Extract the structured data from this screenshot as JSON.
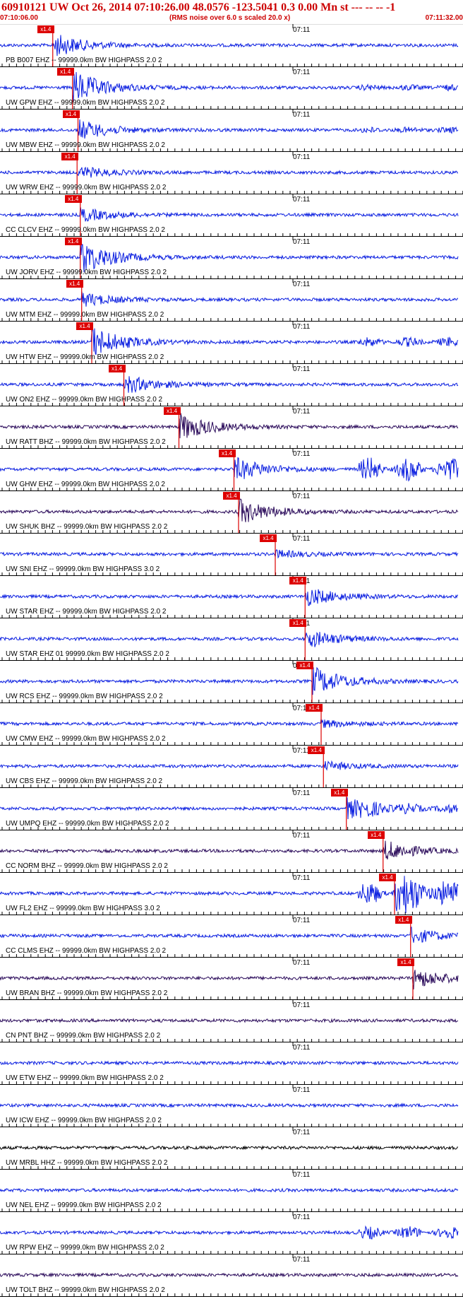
{
  "header": {
    "title": "60910121 UW Oct 26, 2014 07:10:26.00   48.0576 -123.5041  0.3 0.00 Mn st --- -- --  -1",
    "start_time": "07:10:06.00",
    "end_time": "07:11:32.00",
    "rms_note": "(RMS noise over 6.0 s scaled 20.0 x)"
  },
  "colors": {
    "trace_blue": "#0a1ee0",
    "trace_purple": "#2a0a5a",
    "trace_black": "#000000",
    "pick_red": "#dd0000",
    "header_red": "#cc0000"
  },
  "traces": [
    {
      "label": "PB B007 EHZ -- 99999.0km BW  HIGHPASS  2.0  2",
      "tick_label": "07:11",
      "pick_label": "x1.4",
      "color": "#0a1ee0",
      "pick_frac": 0.115,
      "event": 0.7,
      "later": 0.0
    },
    {
      "label": "UW GPW EHZ -- 99999.0km BW  HIGHPASS  2.0  2",
      "tick_label": "07:11",
      "pick_label": "x1.4",
      "color": "#0a1ee0",
      "pick_frac": 0.158,
      "event": 1.0,
      "later": 0.15
    },
    {
      "label": "UW MBW EHZ -- 99999.0km BW  HIGHPASS  2.0  2",
      "tick_label": "07:11",
      "pick_label": "x1.4",
      "color": "#0a1ee0",
      "pick_frac": 0.17,
      "event": 0.6,
      "later": 0.15
    },
    {
      "label": "UW WRW EHZ -- 99999.0km BW  HIGHPASS  2.0  2",
      "tick_label": "07:11",
      "pick_label": "x1.4",
      "color": "#0a1ee0",
      "pick_frac": 0.168,
      "event": 0.35,
      "later": 0.0
    },
    {
      "label": "CC CLCV EHZ -- 99999.0km BW  HIGHPASS  2.0  2",
      "tick_label": "07:11",
      "pick_label": "x1.4",
      "color": "#0a1ee0",
      "pick_frac": 0.175,
      "event": 0.4,
      "later": 0.0
    },
    {
      "label": "UW JORV EHZ -- 99999.0km BW  HIGHPASS  2.0  2",
      "tick_label": "07:11",
      "pick_label": "x1.4",
      "color": "#0a1ee0",
      "pick_frac": 0.175,
      "event": 1.0,
      "later": 0.0
    },
    {
      "label": "UW MTM EHZ -- 99999.0km BW  HIGHPASS  2.0  2",
      "tick_label": "07:11",
      "pick_label": "x1.4",
      "color": "#0a1ee0",
      "pick_frac": 0.178,
      "event": 0.4,
      "later": 0.0
    },
    {
      "label": "UW HTW EHZ -- 99999.0km BW  HIGHPASS  2.0  2",
      "tick_label": "07:11",
      "pick_label": "x1.4",
      "color": "#0a1ee0",
      "pick_frac": 0.2,
      "event": 0.9,
      "later": 0.3
    },
    {
      "label": "UW ON2 EHZ -- 99999.0km BW  HIGHPASS  2.0  2",
      "tick_label": "07:11",
      "pick_label": "x1.4",
      "color": "#0a1ee0",
      "pick_frac": 0.27,
      "event": 0.55,
      "later": 0.0
    },
    {
      "label": "UW RATT BHZ -- 99999.0km BW  HIGHPASS  2.0  2",
      "tick_label": "07:11",
      "pick_label": "x1.4",
      "color": "#2a0a5a",
      "pick_frac": 0.39,
      "event": 0.8,
      "later": 0.0
    },
    {
      "label": "UW GHW EHZ -- 99999.0km BW  HIGHPASS  2.0  2",
      "tick_label": "07:11",
      "pick_label": "x1.4",
      "color": "#0a1ee0",
      "pick_frac": 0.51,
      "event": 0.7,
      "later": 0.95
    },
    {
      "label": "UW SHUK BHZ -- 99999.0km BW  HIGHPASS  2.0  2",
      "tick_label": "07:11",
      "pick_label": "x1.4",
      "color": "#2a0a5a",
      "pick_frac": 0.52,
      "event": 0.75,
      "later": 0.0
    },
    {
      "label": "UW SNI EHZ -- 99999.0km BW  HIGHPASS  3.0  2",
      "tick_label": "07:11",
      "pick_label": "x1.4",
      "color": "#0a1ee0",
      "pick_frac": 0.6,
      "event": 0.2,
      "later": 0.0
    },
    {
      "label": "UW STAR EHZ -- 99999.0km BW  HIGHPASS  2.0  2",
      "tick_label": "07:11",
      "pick_label": "x1.4",
      "color": "#0a1ee0",
      "pick_frac": 0.665,
      "event": 0.55,
      "later": 0.0
    },
    {
      "label": "UW STAR EHZ 01 99999.0km BW  HIGHPASS  2.0  2",
      "tick_label": "07:11",
      "pick_label": "x1.4",
      "color": "#0a1ee0",
      "pick_frac": 0.665,
      "event": 0.55,
      "later": 0.0
    },
    {
      "label": "UW RCS EHZ -- 99999.0km BW  HIGHPASS  2.0  2",
      "tick_label": "07:11",
      "pick_label": "x1.4",
      "color": "#0a1ee0",
      "pick_frac": 0.68,
      "event": 0.85,
      "later": 0.0
    },
    {
      "label": "UW CMW EHZ -- 99999.0km BW  HIGHPASS  2.0  2",
      "tick_label": "07:11",
      "pick_label": "x1.4",
      "color": "#0a1ee0",
      "pick_frac": 0.7,
      "event": 0.2,
      "later": 0.0
    },
    {
      "label": "UW CBS EHZ -- 99999.0km BW  HIGHPASS  2.0  2",
      "tick_label": "07:11",
      "pick_label": "x1.4",
      "color": "#0a1ee0",
      "pick_frac": 0.705,
      "event": 0.25,
      "later": 0.0
    },
    {
      "label": "UW UMPQ EHZ -- 99999.0km BW  HIGHPASS  2.0  2",
      "tick_label": "07:11",
      "pick_label": "x1.4",
      "color": "#0a1ee0",
      "pick_frac": 0.755,
      "event": 0.6,
      "later": 0.25
    },
    {
      "label": "CC NORM BHZ -- 99999.0km BW  HIGHPASS  2.0  2",
      "tick_label": "07:11",
      "pick_label": "x1.4",
      "color": "#2a0a5a",
      "pick_frac": 0.835,
      "event": 0.6,
      "later": 0.0
    },
    {
      "label": "UW FL2 EHZ -- 99999.0km BW  HIGHPASS  3.0  2",
      "tick_label": "07:11",
      "pick_label": "x1.4",
      "color": "#0a1ee0",
      "pick_frac": 0.86,
      "event": 0.9,
      "later": 0.9
    },
    {
      "label": "CC CLMS EHZ -- 99999.0km BW  HIGHPASS  2.0  2",
      "tick_label": "07:11",
      "pick_label": "x1.4",
      "color": "#0a1ee0",
      "pick_frac": 0.895,
      "event": 0.45,
      "later": 0.0
    },
    {
      "label": "UW BRAN BHZ -- 99999.0km BW  HIGHPASS  2.0  2",
      "tick_label": "07:11",
      "pick_label": "x1.4",
      "color": "#2a0a5a",
      "pick_frac": 0.9,
      "event": 0.6,
      "later": 0.0
    },
    {
      "label": "CN PNT BHZ -- 99999.0km BW  HIGHPASS  2.0  2",
      "tick_label": "07:11",
      "pick_label": "",
      "color": "#2a0a5a",
      "pick_frac": null,
      "event": 0.0,
      "later": 0.0
    },
    {
      "label": "UW ETW EHZ -- 99999.0km BW  HIGHPASS  2.0  2",
      "tick_label": "07:11",
      "pick_label": "",
      "color": "#0a1ee0",
      "pick_frac": null,
      "event": 0.0,
      "later": 0.0
    },
    {
      "label": "UW ICW EHZ -- 99999.0km BW  HIGHPASS  2.0  2",
      "tick_label": "07:11",
      "pick_label": "",
      "color": "#0a1ee0",
      "pick_frac": null,
      "event": 0.0,
      "later": 0.0
    },
    {
      "label": "UW MRBL HHZ -- 99999.0km BW  HIGHPASS  2.0  2",
      "tick_label": "07:11",
      "pick_label": "",
      "color": "#000000",
      "pick_frac": null,
      "event": 0.0,
      "later": 0.0
    },
    {
      "label": "UW NEL EHZ -- 99999.0km BW  HIGHPASS  2.0  2",
      "tick_label": "07:11",
      "pick_label": "",
      "color": "#0a1ee0",
      "pick_frac": null,
      "event": 0.0,
      "later": 0.0
    },
    {
      "label": "UW RPW EHZ -- 99999.0km BW  HIGHPASS  2.0  2",
      "tick_label": "07:11",
      "pick_label": "",
      "color": "#0a1ee0",
      "pick_frac": null,
      "event": 0.0,
      "later": 0.45
    },
    {
      "label": "UW TOLT BHZ -- 99999.0km BW  HIGHPASS  2.0  2",
      "tick_label": "07:11",
      "pick_label": "",
      "color": "#2a0a5a",
      "pick_frac": null,
      "event": 0.0,
      "later": 0.0
    }
  ]
}
